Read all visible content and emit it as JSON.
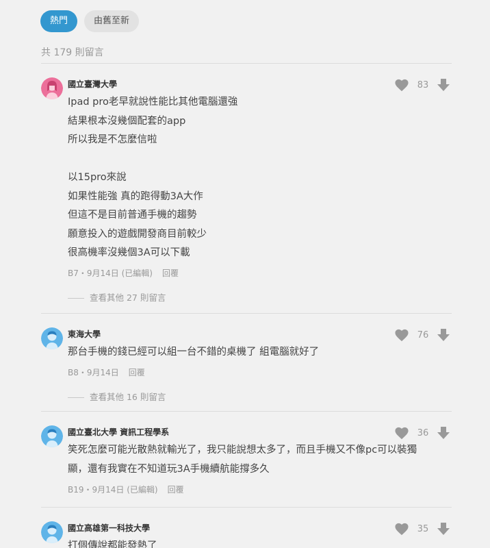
{
  "sort": {
    "hot": "熱門",
    "old_to_new": "由舊至新"
  },
  "comment_count": "共 179 則留言",
  "comments": [
    {
      "school": "國立臺灣大學",
      "lines": [
        "Ipad pro老早就說性能比其他電腦還強",
        "結果根本沒幾個配套的app",
        "所以我是不怎麼信啦",
        "",
        "以15pro來說",
        "如果性能強 真的跑得動3A大作",
        "但這不是目前普通手機的趨勢",
        "願意投入的遊戲開發商目前較少",
        "很高機率沒幾個3A可以下載"
      ],
      "meta": "B7・9月14日 (已編輯)",
      "reply": "回覆",
      "likes": "83",
      "more": "查看其他 27 則留言",
      "avatar_color": "#ec6f9a"
    },
    {
      "school": "東海大學",
      "lines": [
        "那台手機的錢已經可以組一台不錯的桌機了 組電腦就好了"
      ],
      "meta": "B8・9月14日",
      "reply": "回覆",
      "likes": "76",
      "more": "查看其他 16 則留言",
      "avatar_color": "#5fb4e8"
    },
    {
      "school": "國立臺北大學 資訊工程學系",
      "lines": [
        "笑死怎麼可能光散熱就輸光了，我只能說想太多了，而且手機又不像pc可以裝獨",
        "顯，還有我實在不知道玩3A手機續航能撐多久"
      ],
      "meta": "B19・9月14日 (已編輯)",
      "reply": "回覆",
      "likes": "36",
      "avatar_color": "#5fb4e8"
    },
    {
      "school": "國立高雄第一科技大學",
      "lines": [
        "打個傳說都能發熱了"
      ],
      "likes": "35",
      "avatar_color": "#5fb4e8"
    }
  ],
  "icons": {
    "like": "heart-icon",
    "dislike": "down-arrow-icon"
  }
}
